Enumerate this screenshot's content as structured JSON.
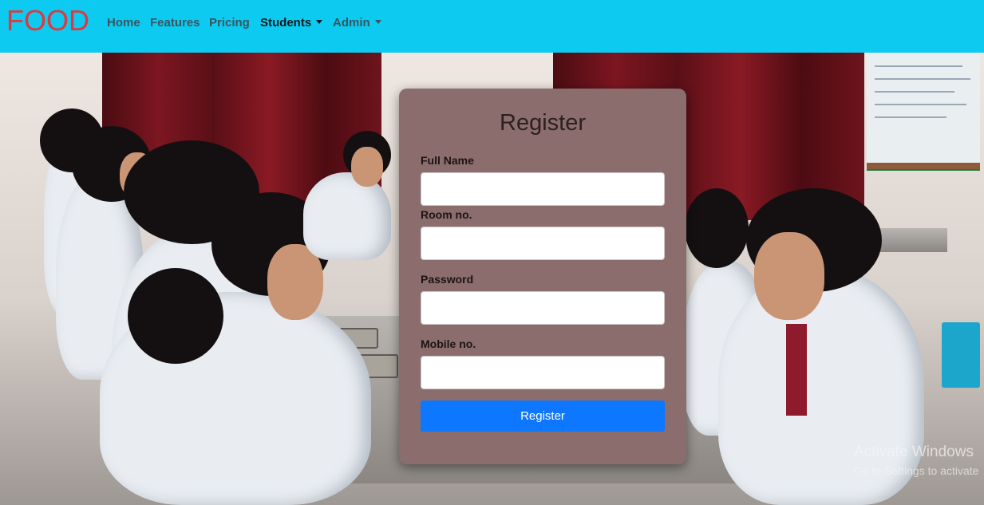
{
  "navbar": {
    "brand": "FOOD",
    "items": [
      {
        "label": "Home"
      },
      {
        "label": "Features"
      },
      {
        "label": "Pricing"
      },
      {
        "label": "Students"
      },
      {
        "label": "Admin"
      }
    ]
  },
  "form": {
    "title": "Register",
    "fields": [
      {
        "label": "Full Name",
        "value": ""
      },
      {
        "label": "Room no.",
        "value": ""
      },
      {
        "label": "Password",
        "value": ""
      },
      {
        "label": "Mobile no.",
        "value": ""
      }
    ],
    "submit_label": "Register"
  },
  "watermark": {
    "title": "Activate Windows",
    "subtitle": "Go to Settings to activate"
  },
  "colors": {
    "navbar_bg": "#0dcaf0",
    "brand": "#e0383e",
    "card_bg": "#8b6d6e",
    "button_bg": "#0d78ff"
  }
}
